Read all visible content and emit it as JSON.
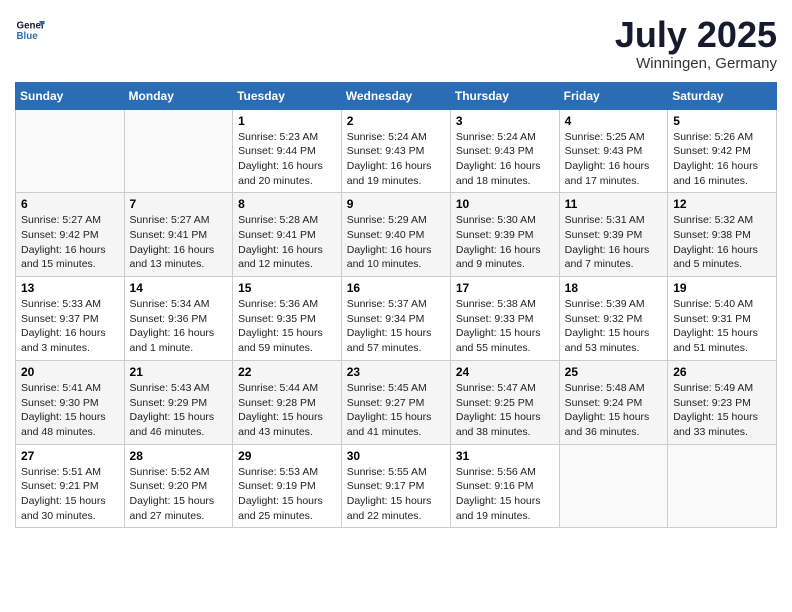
{
  "logo": {
    "line1": "General",
    "line2": "Blue"
  },
  "title": {
    "month_year": "July 2025",
    "location": "Winningen, Germany"
  },
  "weekdays": [
    "Sunday",
    "Monday",
    "Tuesday",
    "Wednesday",
    "Thursday",
    "Friday",
    "Saturday"
  ],
  "weeks": [
    [
      {
        "day": "",
        "info": ""
      },
      {
        "day": "",
        "info": ""
      },
      {
        "day": "1",
        "info": "Sunrise: 5:23 AM\nSunset: 9:44 PM\nDaylight: 16 hours\nand 20 minutes."
      },
      {
        "day": "2",
        "info": "Sunrise: 5:24 AM\nSunset: 9:43 PM\nDaylight: 16 hours\nand 19 minutes."
      },
      {
        "day": "3",
        "info": "Sunrise: 5:24 AM\nSunset: 9:43 PM\nDaylight: 16 hours\nand 18 minutes."
      },
      {
        "day": "4",
        "info": "Sunrise: 5:25 AM\nSunset: 9:43 PM\nDaylight: 16 hours\nand 17 minutes."
      },
      {
        "day": "5",
        "info": "Sunrise: 5:26 AM\nSunset: 9:42 PM\nDaylight: 16 hours\nand 16 minutes."
      }
    ],
    [
      {
        "day": "6",
        "info": "Sunrise: 5:27 AM\nSunset: 9:42 PM\nDaylight: 16 hours\nand 15 minutes."
      },
      {
        "day": "7",
        "info": "Sunrise: 5:27 AM\nSunset: 9:41 PM\nDaylight: 16 hours\nand 13 minutes."
      },
      {
        "day": "8",
        "info": "Sunrise: 5:28 AM\nSunset: 9:41 PM\nDaylight: 16 hours\nand 12 minutes."
      },
      {
        "day": "9",
        "info": "Sunrise: 5:29 AM\nSunset: 9:40 PM\nDaylight: 16 hours\nand 10 minutes."
      },
      {
        "day": "10",
        "info": "Sunrise: 5:30 AM\nSunset: 9:39 PM\nDaylight: 16 hours\nand 9 minutes."
      },
      {
        "day": "11",
        "info": "Sunrise: 5:31 AM\nSunset: 9:39 PM\nDaylight: 16 hours\nand 7 minutes."
      },
      {
        "day": "12",
        "info": "Sunrise: 5:32 AM\nSunset: 9:38 PM\nDaylight: 16 hours\nand 5 minutes."
      }
    ],
    [
      {
        "day": "13",
        "info": "Sunrise: 5:33 AM\nSunset: 9:37 PM\nDaylight: 16 hours\nand 3 minutes."
      },
      {
        "day": "14",
        "info": "Sunrise: 5:34 AM\nSunset: 9:36 PM\nDaylight: 16 hours\nand 1 minute."
      },
      {
        "day": "15",
        "info": "Sunrise: 5:36 AM\nSunset: 9:35 PM\nDaylight: 15 hours\nand 59 minutes."
      },
      {
        "day": "16",
        "info": "Sunrise: 5:37 AM\nSunset: 9:34 PM\nDaylight: 15 hours\nand 57 minutes."
      },
      {
        "day": "17",
        "info": "Sunrise: 5:38 AM\nSunset: 9:33 PM\nDaylight: 15 hours\nand 55 minutes."
      },
      {
        "day": "18",
        "info": "Sunrise: 5:39 AM\nSunset: 9:32 PM\nDaylight: 15 hours\nand 53 minutes."
      },
      {
        "day": "19",
        "info": "Sunrise: 5:40 AM\nSunset: 9:31 PM\nDaylight: 15 hours\nand 51 minutes."
      }
    ],
    [
      {
        "day": "20",
        "info": "Sunrise: 5:41 AM\nSunset: 9:30 PM\nDaylight: 15 hours\nand 48 minutes."
      },
      {
        "day": "21",
        "info": "Sunrise: 5:43 AM\nSunset: 9:29 PM\nDaylight: 15 hours\nand 46 minutes."
      },
      {
        "day": "22",
        "info": "Sunrise: 5:44 AM\nSunset: 9:28 PM\nDaylight: 15 hours\nand 43 minutes."
      },
      {
        "day": "23",
        "info": "Sunrise: 5:45 AM\nSunset: 9:27 PM\nDaylight: 15 hours\nand 41 minutes."
      },
      {
        "day": "24",
        "info": "Sunrise: 5:47 AM\nSunset: 9:25 PM\nDaylight: 15 hours\nand 38 minutes."
      },
      {
        "day": "25",
        "info": "Sunrise: 5:48 AM\nSunset: 9:24 PM\nDaylight: 15 hours\nand 36 minutes."
      },
      {
        "day": "26",
        "info": "Sunrise: 5:49 AM\nSunset: 9:23 PM\nDaylight: 15 hours\nand 33 minutes."
      }
    ],
    [
      {
        "day": "27",
        "info": "Sunrise: 5:51 AM\nSunset: 9:21 PM\nDaylight: 15 hours\nand 30 minutes."
      },
      {
        "day": "28",
        "info": "Sunrise: 5:52 AM\nSunset: 9:20 PM\nDaylight: 15 hours\nand 27 minutes."
      },
      {
        "day": "29",
        "info": "Sunrise: 5:53 AM\nSunset: 9:19 PM\nDaylight: 15 hours\nand 25 minutes."
      },
      {
        "day": "30",
        "info": "Sunrise: 5:55 AM\nSunset: 9:17 PM\nDaylight: 15 hours\nand 22 minutes."
      },
      {
        "day": "31",
        "info": "Sunrise: 5:56 AM\nSunset: 9:16 PM\nDaylight: 15 hours\nand 19 minutes."
      },
      {
        "day": "",
        "info": ""
      },
      {
        "day": "",
        "info": ""
      }
    ]
  ]
}
